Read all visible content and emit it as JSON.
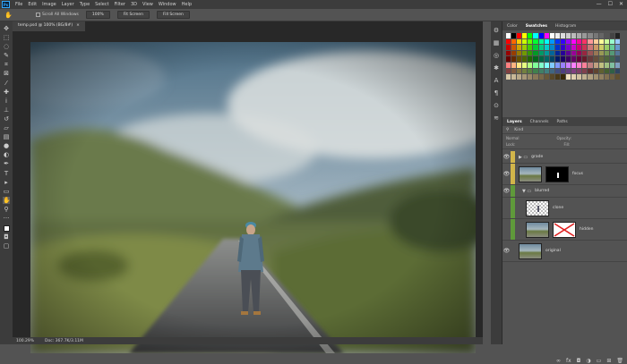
{
  "app": {
    "logo_text": "Ps"
  },
  "menubar": {
    "items": [
      "File",
      "Edit",
      "Image",
      "Layer",
      "Type",
      "Select",
      "Filter",
      "3D",
      "View",
      "Window",
      "Help"
    ]
  },
  "window_controls": {
    "minimize": "—",
    "maximize": "☐",
    "close": "✕"
  },
  "optionsbar": {
    "checkbox_label": "Scroll All Windows",
    "btn_100": "100%",
    "btn_fit": "Fit Screen",
    "btn_fill": "Fill Screen"
  },
  "document": {
    "tab_title": "temp.psd @ 100% (BG/8#)",
    "tab_close": "×",
    "zoom_status": "100.29%",
    "doc_status": "Doc: 367.7K/3.11M"
  },
  "colors": {
    "layer_yellow": "#d1b54a",
    "layer_green": "#5f9a3a",
    "layer_blue": "#3a6f99",
    "canvas_green": "#6f7a4f"
  },
  "panels": {
    "color_tabs": [
      "Color",
      "Swatches",
      "Histogram"
    ],
    "active_color_tab": "Swatches",
    "layer_tabs": [
      "Layers",
      "Channels",
      "Paths"
    ],
    "active_layer_tab": "Layers",
    "filter_label": "Kind",
    "blend_mode": "Normal",
    "opacity_label": "Opacity:",
    "lock_label": "Lock:",
    "fill_label": "Fill:"
  },
  "layers": [
    {
      "name": "grade",
      "type": "group",
      "eye": "👁"
    },
    {
      "name": "focus",
      "type": "layer-mask",
      "eye": "👁"
    },
    {
      "name": "blurred",
      "type": "group",
      "eye": "👁"
    },
    {
      "name": "clone",
      "type": "layer",
      "eye": ""
    },
    {
      "name": "hidden",
      "type": "layer-mask",
      "eye": ""
    },
    {
      "name": "original",
      "type": "layer",
      "eye": "👁"
    }
  ],
  "swatches": [
    "#ffffff",
    "#000000",
    "#ff0000",
    "#ffff00",
    "#00ff00",
    "#00ffff",
    "#0000ff",
    "#ff00ff",
    "#ffffff",
    "#eeeeee",
    "#dddddd",
    "#cccccc",
    "#bbbbbb",
    "#aaaaaa",
    "#999999",
    "#888888",
    "#777777",
    "#666666",
    "#555555",
    "#444444",
    "#222222",
    "#ff0000",
    "#ff6600",
    "#ffcc00",
    "#ccff00",
    "#66ff00",
    "#00ff33",
    "#00ff99",
    "#00ffff",
    "#0099ff",
    "#0033ff",
    "#3300ff",
    "#9900ff",
    "#ff00ff",
    "#ff0099",
    "#ff3366",
    "#ff9999",
    "#ffcc99",
    "#ffff99",
    "#ccff99",
    "#99ffcc",
    "#99ccff",
    "#cc0000",
    "#cc5500",
    "#cca300",
    "#99cc00",
    "#44cc00",
    "#00cc33",
    "#00cc88",
    "#00cccc",
    "#0088cc",
    "#0033cc",
    "#3300cc",
    "#7a00cc",
    "#cc00cc",
    "#cc0077",
    "#cc3355",
    "#cc7777",
    "#cc9966",
    "#cccc66",
    "#99cc66",
    "#66cc99",
    "#6699cc",
    "#990000",
    "#993d00",
    "#997a00",
    "#729900",
    "#339900",
    "#009926",
    "#009966",
    "#009999",
    "#006699",
    "#002699",
    "#260099",
    "#5c0099",
    "#990099",
    "#990059",
    "#992640",
    "#995555",
    "#997755",
    "#999955",
    "#779955",
    "#559977",
    "#557799",
    "#660000",
    "#662900",
    "#665200",
    "#4c6600",
    "#226600",
    "#00661a",
    "#006644",
    "#006666",
    "#004466",
    "#001a66",
    "#1a0066",
    "#3d0066",
    "#660066",
    "#66003b",
    "#661a2a",
    "#663c3c",
    "#664f3c",
    "#66663c",
    "#4f663c",
    "#3c664f",
    "#3c4f66",
    "#ff8080",
    "#ffb380",
    "#ffe680",
    "#e6ff80",
    "#b3ff80",
    "#80ff99",
    "#80ffcc",
    "#80ffff",
    "#80ccff",
    "#8099ff",
    "#9980ff",
    "#cc80ff",
    "#ff80ff",
    "#ff80cc",
    "#ff8099",
    "#c08080",
    "#c0a080",
    "#c0c080",
    "#a0c080",
    "#80c0a0",
    "#80a0c0",
    "#804040",
    "#805a40",
    "#807340",
    "#738040",
    "#5a8040",
    "#40804d",
    "#408066",
    "#408080",
    "#406680",
    "#404d80",
    "#4d4080",
    "#664080",
    "#804080",
    "#804066",
    "#80404d",
    "#603030",
    "#604530",
    "#606030",
    "#456030",
    "#306045",
    "#304560",
    "#d8c8a8",
    "#c8b898",
    "#b8a888",
    "#a89878",
    "#988868",
    "#887858",
    "#786848",
    "#685838",
    "#584828",
    "#483818",
    "#382808",
    "#f0e0c0",
    "#e0d0b0",
    "#d0c0a0",
    "#c0b090",
    "#b0a080",
    "#a09070",
    "#908060",
    "#807050",
    "#706040",
    "#605030"
  ]
}
